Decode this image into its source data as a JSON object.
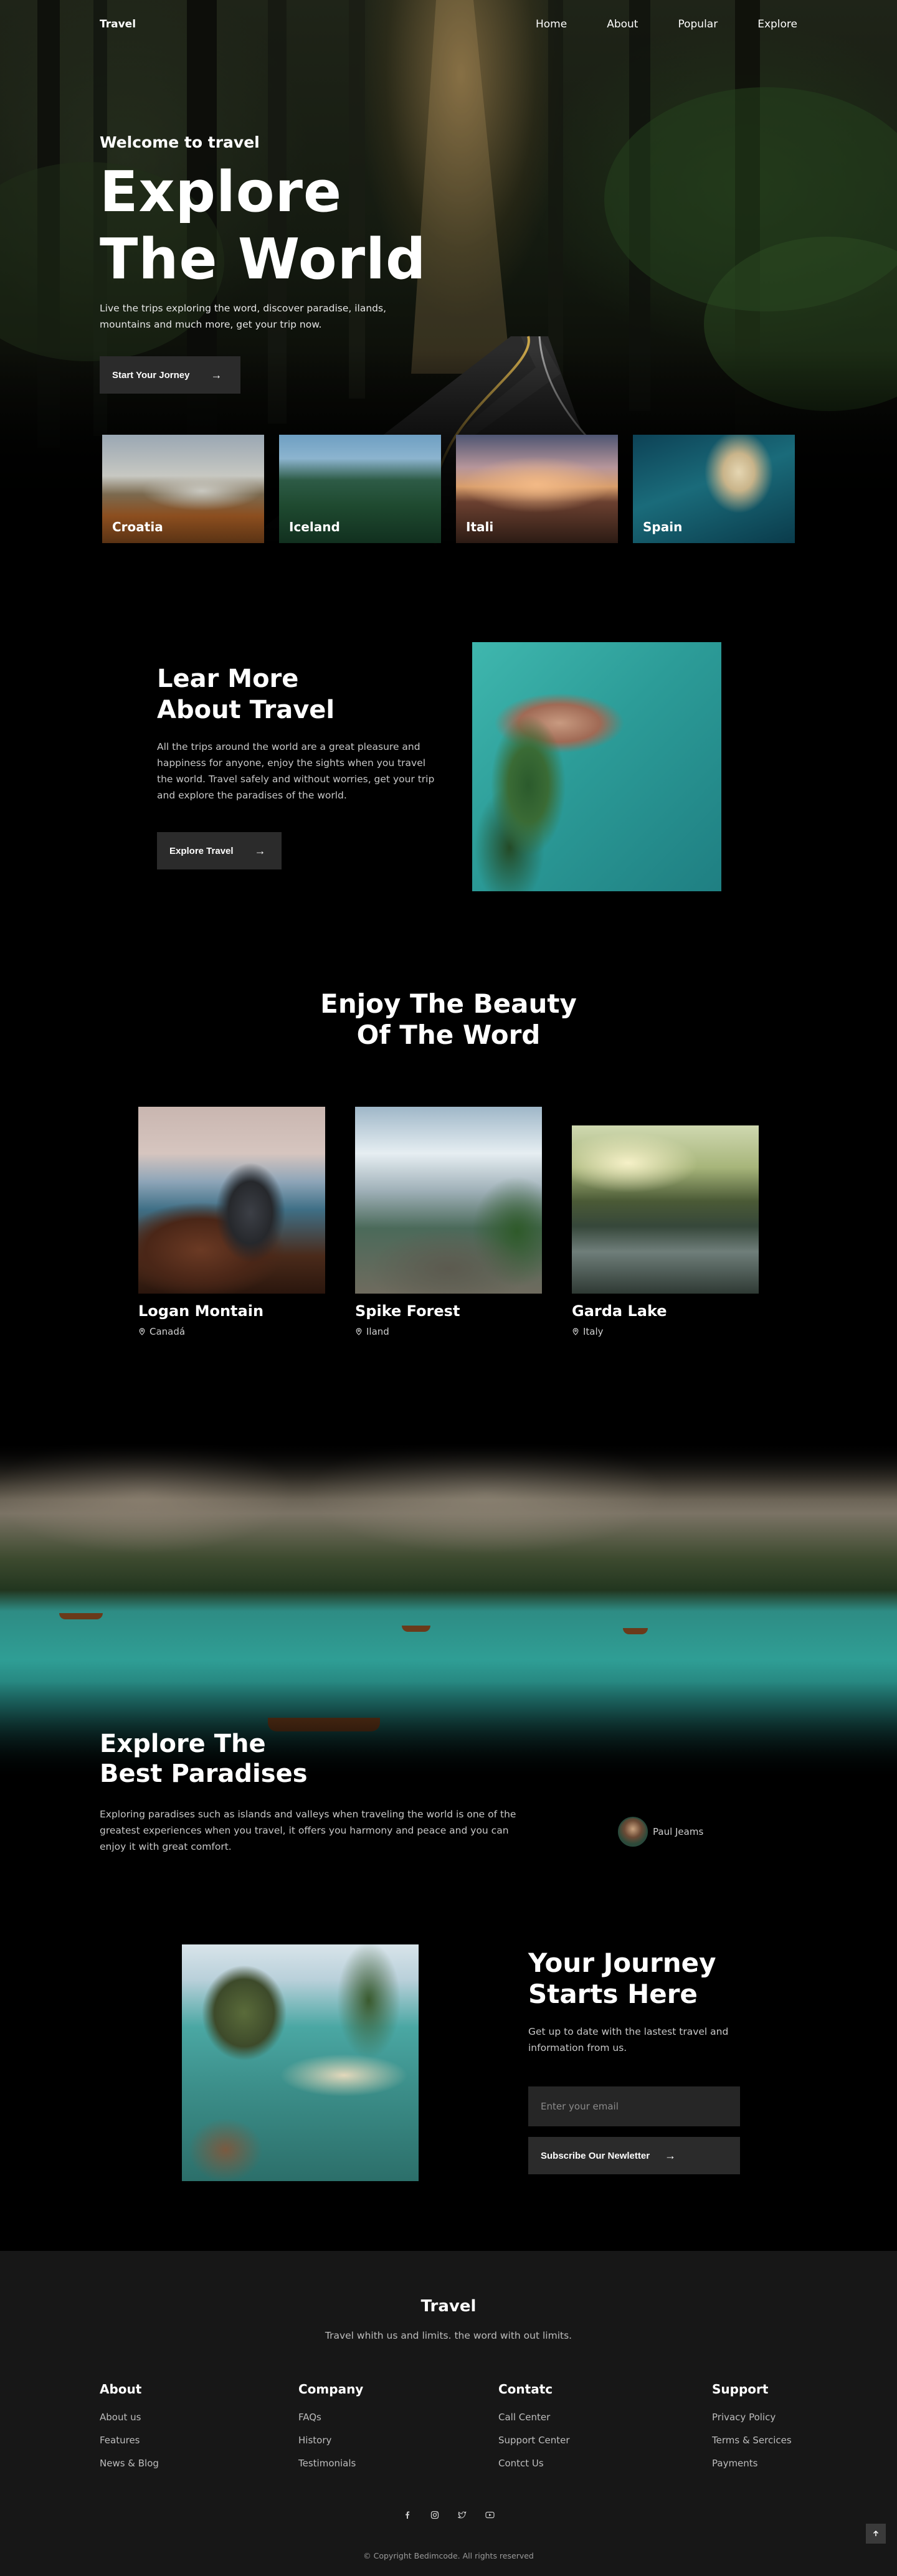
{
  "nav": {
    "logo": "Travel",
    "items": [
      "Home",
      "About",
      "Popular",
      "Explore"
    ]
  },
  "hero": {
    "kicker": "Welcome to travel",
    "title_line1": "Explore",
    "title_line2": "The World",
    "description": "Live the trips exploring the word, discover paradise, ilands, mountains and much more, get your trip now.",
    "button_label": "Start Your Jorney"
  },
  "destinations": [
    "Croatia",
    "Iceland",
    "Itali",
    "Spain"
  ],
  "learn_more": {
    "title_line1": "Lear More",
    "title_line2": "About Travel",
    "description": "All the trips around the world are a great pleasure and happiness for anyone, enjoy the sights when you travel the world. Travel safely and without worries, get your trip and explore the paradises of the world.",
    "button_label": "Explore Travel"
  },
  "beauty": {
    "title_line1": "Enjoy The Beauty",
    "title_line2": "Of The Word",
    "places": [
      {
        "name": "Logan Montain",
        "location": "Canadá"
      },
      {
        "name": "Spike Forest",
        "location": "Iland"
      },
      {
        "name": "Garda Lake",
        "location": "Italy"
      }
    ]
  },
  "paradise": {
    "title_line1": "Explore The",
    "title_line2": "Best Paradises",
    "description": "Exploring paradises such as islands and valleys when traveling the world is one of the greatest experiences when you travel, it offers you harmony and peace and you can enjoy it with great comfort.",
    "author": "Paul Jeams"
  },
  "journey": {
    "title_line1": "Your Journey",
    "title_line2": "Starts Here",
    "description": "Get up to date with the lastest travel and information from us.",
    "email_placeholder": "Enter your email",
    "button_label": "Subscribe Our Newletter"
  },
  "footer": {
    "logo": "Travel",
    "tagline": "Travel whith us and limits. the word with out limits.",
    "columns": [
      {
        "title": "About",
        "links": [
          "About us",
          "Features",
          "News & Blog"
        ]
      },
      {
        "title": "Company",
        "links": [
          "FAQs",
          "History",
          "Testimonials"
        ]
      },
      {
        "title": "Contatc",
        "links": [
          "Call Center",
          "Support Center",
          "Contct Us"
        ]
      },
      {
        "title": "Support",
        "links": [
          "Privacy Policy",
          "Terms & Sercices",
          "Payments"
        ]
      }
    ],
    "socials": [
      "facebook-icon",
      "instagram-icon",
      "twitter-icon",
      "youtube-icon"
    ],
    "copyright": "© Copyright Bedimcode. All rights reserved"
  },
  "colors": {
    "background": "#000000",
    "button": "#2b2b2b",
    "footer": "#171717",
    "text": "#ffffff",
    "muted_text": "#c8c8c8"
  }
}
